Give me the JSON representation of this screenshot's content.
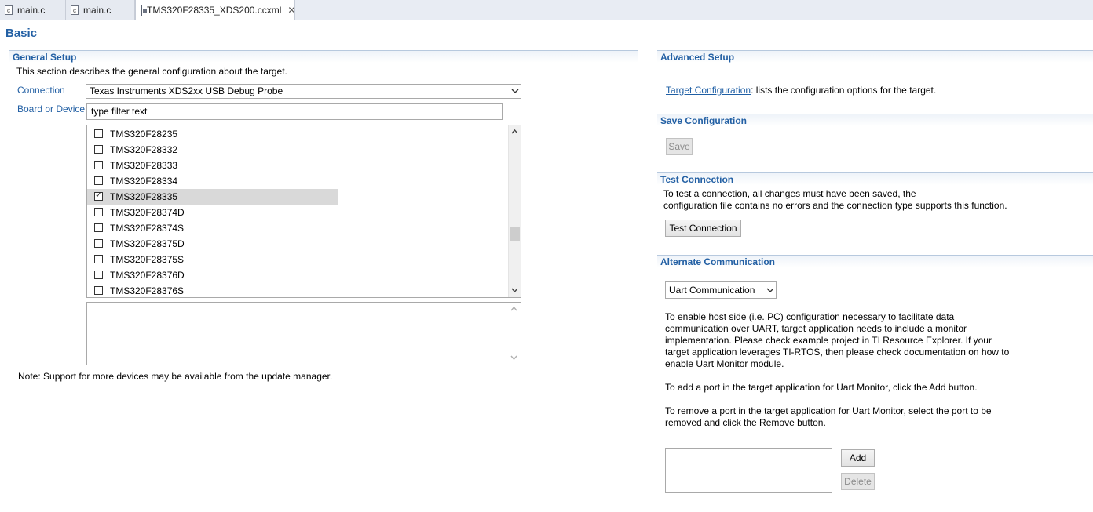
{
  "tabs": [
    {
      "label": "main.c",
      "icon": "c-file-icon"
    },
    {
      "label": "main.c",
      "icon": "c-file-icon"
    },
    {
      "label": "TMS320F28335_XDS200.ccxml",
      "icon": "ccxml-file-icon",
      "active": true
    }
  ],
  "page_title": "Basic",
  "general_setup": {
    "heading": "General Setup",
    "description": "This section describes the general configuration about the target.",
    "connection_label": "Connection",
    "connection_value": "Texas Instruments XDS2xx USB Debug Probe",
    "board_label": "Board or Device",
    "filter_placeholder": "type filter text",
    "devices": [
      {
        "name": "TMS320F28235",
        "checked": false
      },
      {
        "name": "TMS320F28332",
        "checked": false
      },
      {
        "name": "TMS320F28333",
        "checked": false
      },
      {
        "name": "TMS320F28334",
        "checked": false
      },
      {
        "name": "TMS320F28335",
        "checked": true
      },
      {
        "name": "TMS320F28374D",
        "checked": false
      },
      {
        "name": "TMS320F28374S",
        "checked": false
      },
      {
        "name": "TMS320F28375D",
        "checked": false
      },
      {
        "name": "TMS320F28375S",
        "checked": false
      },
      {
        "name": "TMS320F28376D",
        "checked": false
      },
      {
        "name": "TMS320F28376S",
        "checked": false
      }
    ],
    "note": "Note: Support for more devices may be available from the update manager."
  },
  "advanced_setup": {
    "heading": "Advanced Setup",
    "link_text": "Target Configuration",
    "link_suffix": ": lists the configuration options for the target."
  },
  "save_configuration": {
    "heading": "Save Configuration",
    "save_label": "Save"
  },
  "test_connection": {
    "heading": "Test Connection",
    "line1": "To test a connection, all changes must have been saved, the",
    "line2": "configuration file contains no errors and the connection type supports this function.",
    "button_label": "Test Connection"
  },
  "alternate_communication": {
    "heading": "Alternate Communication",
    "select_value": "Uart Communication",
    "para1": [
      "To enable host side (i.e. PC) configuration necessary to facilitate data",
      "communication over UART, target application needs to include a monitor",
      "implementation. Please check example project in TI Resource Explorer. If your",
      "target application leverages TI-RTOS, then please check documentation on how to",
      "enable Uart Monitor module."
    ],
    "para2": "To add a port in the target application for Uart Monitor, click the Add button.",
    "para3": [
      "To remove a port in the target application for Uart Monitor, select the port to be",
      "removed and click the Remove button."
    ],
    "add_label": "Add",
    "delete_label": "Delete"
  }
}
